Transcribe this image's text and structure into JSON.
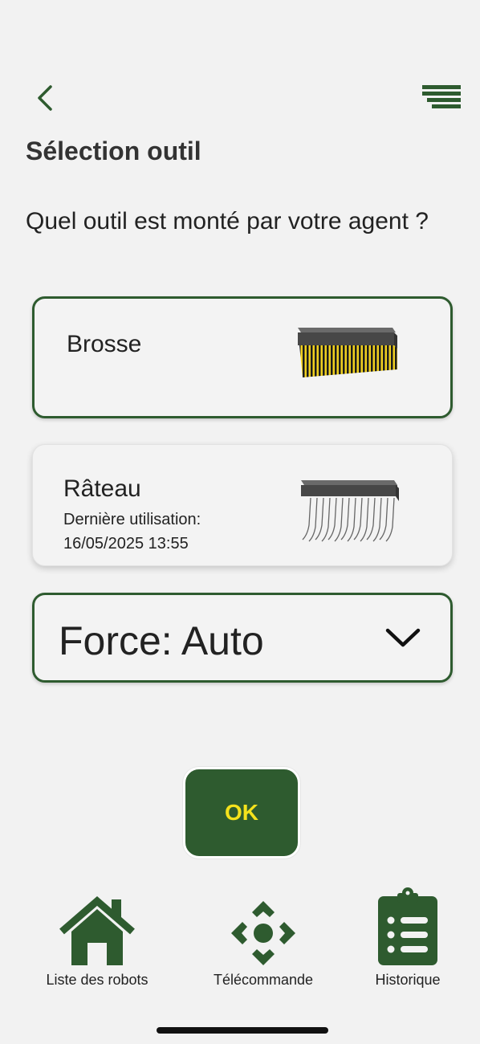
{
  "header": {
    "back_icon": "chevron-left-icon",
    "menu_icon": "menu-lines-icon",
    "title": "Sélection outil"
  },
  "question": "Quel outil est monté par votre agent ?",
  "tools": [
    {
      "name": "Brosse",
      "selected": true,
      "meta_line1": "",
      "meta_line2": "",
      "image": "brush-tool-image"
    },
    {
      "name": "Râteau",
      "selected": false,
      "meta_line1": "Dernière utilisation:",
      "meta_line2": "16/05/2025 13:55",
      "image": "rake-tool-image"
    }
  ],
  "force": {
    "label": "Force: Auto",
    "icon": "chevron-down-icon"
  },
  "ok_label": "OK",
  "bottom_nav": [
    {
      "label": "Liste des robots",
      "icon": "home-icon"
    },
    {
      "label": "Télécommande",
      "icon": "remote-control-icon"
    },
    {
      "label": "Historique",
      "icon": "clipboard-list-icon"
    }
  ],
  "colors": {
    "primary": "#2e5b2f",
    "ok_text": "#f4e21c",
    "background": "#f2f2f2"
  }
}
